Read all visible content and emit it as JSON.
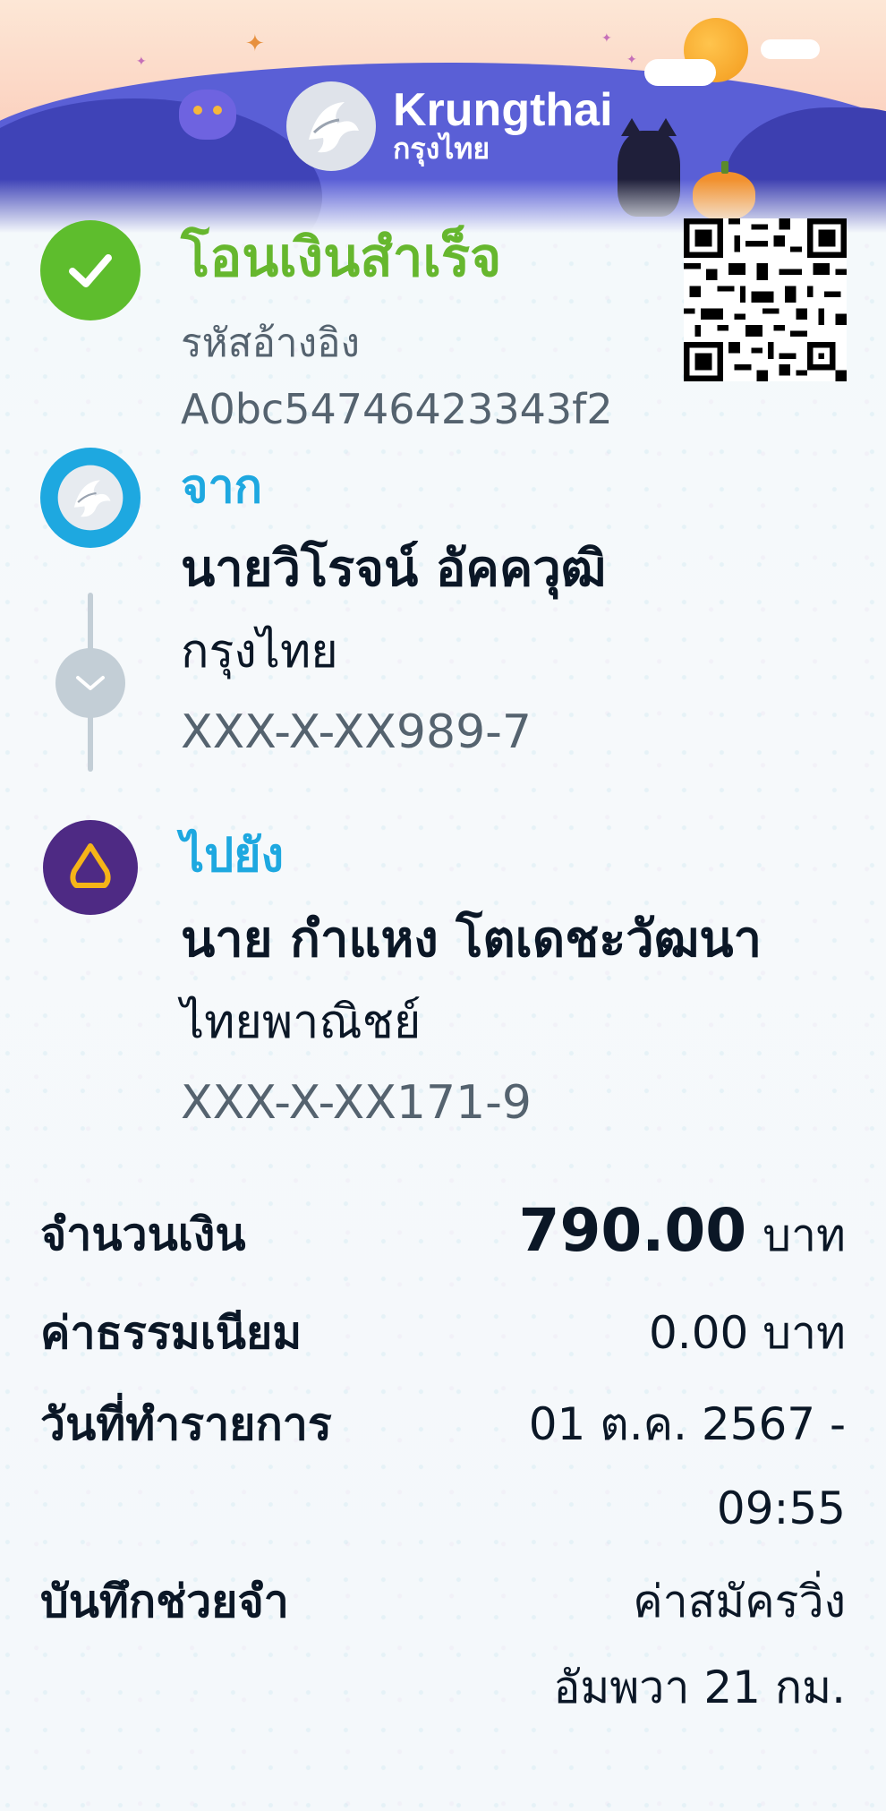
{
  "header": {
    "brand_en": "Krungthai",
    "brand_th": "กรุงไทย"
  },
  "status": {
    "title": "โอนเงินสำเร็จ",
    "ref_label": "รหัสอ้างอิง",
    "ref_value": "A0bc54746423343f2",
    "color": "#5ebd2d"
  },
  "from": {
    "label": "จาก",
    "name": "นายวิโรจน์ อัคควุฒิ",
    "bank": "กรุงไทย",
    "account": "XXX-X-XX989-7",
    "icon": "krungthai-logo-icon",
    "color": "#1ea8e0"
  },
  "to": {
    "label": "ไปยัง",
    "name": "นาย กำแหง โตเดชะวัฒนา",
    "bank": "ไทยพาณิชย์",
    "account": "XXX-X-XX171-9",
    "icon": "scb-logo-icon",
    "color": "#4e2a84"
  },
  "details": {
    "amount_label": "จำนวนเงิน",
    "amount_value": "790.00",
    "amount_unit": "บาท",
    "fee_label": "ค่าธรรมเนียม",
    "fee_value": "0.00 บาท",
    "date_label": "วันที่ทำรายการ",
    "date_line1": "01 ต.ค. 2567 -",
    "date_line2": "09:55",
    "memo_label": "บันทึกช่วยจำ",
    "memo_line1": "ค่าสมัครวิ่ง",
    "memo_line2": "อัมพวา 21 กม."
  }
}
